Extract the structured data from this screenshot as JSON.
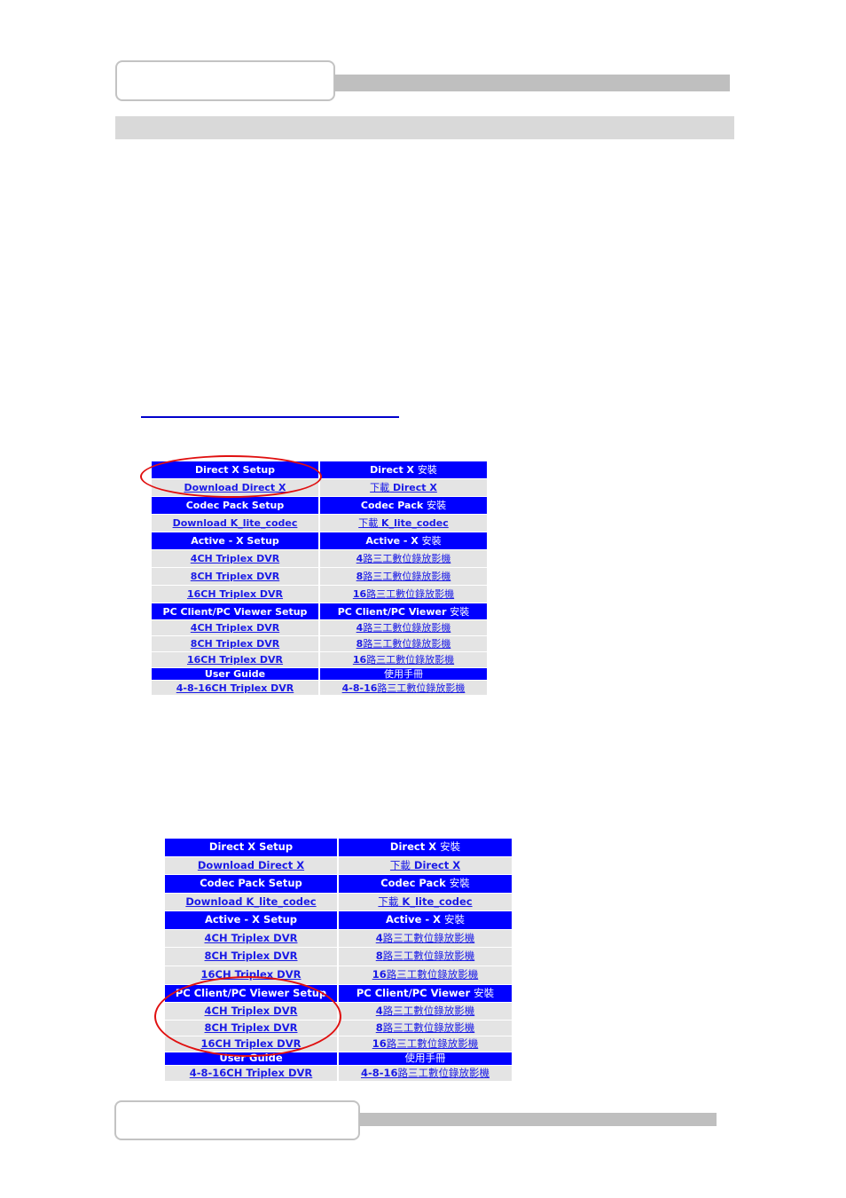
{
  "header": {
    "top_box_label": "",
    "bottom_box_label": ""
  },
  "link_rule": "",
  "colors": {
    "header_cell": "#0000ff",
    "link_cell": "#e4e4e4",
    "link_text": "#1a1ae6",
    "highlight_ellipse": "#e01010",
    "gray_bar": "#bfbfbf",
    "gray_band": "#d9d9d9"
  },
  "tables": [
    {
      "highlight": "Direct X Setup / Download Direct X",
      "rows": [
        {
          "type": "head",
          "en": "Direct X Setup",
          "zh_prefix": "Direct X ",
          "zh": "安裝",
          "zh_suffix": ""
        },
        {
          "type": "link",
          "en": "Download Direct X",
          "zh_prefix": "",
          "zh": "下載",
          "zh_suffix": " Direct X"
        },
        {
          "type": "head",
          "en": "Codec Pack Setup",
          "zh_prefix": "Codec Pack ",
          "zh": "安裝",
          "zh_suffix": ""
        },
        {
          "type": "link",
          "en": "Download K_lite_codec",
          "zh_prefix": "",
          "zh": "下載",
          "zh_suffix": " K_lite_codec"
        },
        {
          "type": "head",
          "en": "Active - X Setup",
          "zh_prefix": "Active - X ",
          "zh": "安裝",
          "zh_suffix": ""
        },
        {
          "type": "link",
          "en": "4CH Triplex DVR",
          "zh_prefix": "4",
          "zh": "路三工數位錄放影機",
          "zh_suffix": ""
        },
        {
          "type": "link",
          "en": "8CH Triplex DVR",
          "zh_prefix": "8",
          "zh": "路三工數位錄放影機",
          "zh_suffix": ""
        },
        {
          "type": "link",
          "en": "16CH Triplex DVR",
          "zh_prefix": "16",
          "zh": "路三工數位錄放影機",
          "zh_suffix": ""
        },
        {
          "type": "head",
          "en": "PC Client/PC Viewer Setup",
          "zh_prefix": "PC Client/PC Viewer ",
          "zh": "安裝",
          "zh_suffix": ""
        },
        {
          "type": "link",
          "en": "4CH Triplex DVR",
          "zh_prefix": "4",
          "zh": "路三工數位錄放影機",
          "zh_suffix": ""
        },
        {
          "type": "link",
          "en": "8CH Triplex DVR",
          "zh_prefix": "8",
          "zh": "路三工數位錄放影機",
          "zh_suffix": ""
        },
        {
          "type": "link",
          "en": "16CH Triplex DVR",
          "zh_prefix": "16",
          "zh": "路三工數位錄放影機",
          "zh_suffix": ""
        },
        {
          "type": "head",
          "en": "User Guide",
          "zh_prefix": "",
          "zh": "使用手冊",
          "zh_suffix": ""
        },
        {
          "type": "link",
          "en": "4-8-16CH Triplex DVR",
          "zh_prefix": "4-8-16",
          "zh": "路三工數位錄放影機",
          "zh_suffix": ""
        }
      ]
    },
    {
      "highlight": "PC Client/PC Viewer Setup / 4CH, 8CH, 16CH Triplex DVR",
      "rows": [
        {
          "type": "head",
          "en": "Direct X Setup",
          "zh_prefix": "Direct X ",
          "zh": "安裝",
          "zh_suffix": ""
        },
        {
          "type": "link",
          "en": "Download Direct X",
          "zh_prefix": "",
          "zh": "下載",
          "zh_suffix": " Direct X"
        },
        {
          "type": "head",
          "en": "Codec Pack Setup",
          "zh_prefix": "Codec Pack ",
          "zh": "安裝",
          "zh_suffix": ""
        },
        {
          "type": "link",
          "en": "Download K_lite_codec",
          "zh_prefix": "",
          "zh": "下載",
          "zh_suffix": " K_lite_codec"
        },
        {
          "type": "head",
          "en": "Active - X Setup",
          "zh_prefix": "Active - X ",
          "zh": "安裝",
          "zh_suffix": ""
        },
        {
          "type": "link",
          "en": "4CH Triplex DVR",
          "zh_prefix": "4",
          "zh": "路三工數位錄放影機",
          "zh_suffix": ""
        },
        {
          "type": "link",
          "en": "8CH Triplex DVR",
          "zh_prefix": "8",
          "zh": "路三工數位錄放影機",
          "zh_suffix": ""
        },
        {
          "type": "link",
          "en": "16CH Triplex DVR",
          "zh_prefix": "16",
          "zh": "路三工數位錄放影機",
          "zh_suffix": ""
        },
        {
          "type": "head",
          "en": "PC Client/PC Viewer Setup",
          "zh_prefix": "PC Client/PC Viewer ",
          "zh": "安裝",
          "zh_suffix": ""
        },
        {
          "type": "link",
          "en": "4CH Triplex DVR",
          "zh_prefix": "4",
          "zh": "路三工數位錄放影機",
          "zh_suffix": ""
        },
        {
          "type": "link",
          "en": "8CH Triplex DVR",
          "zh_prefix": "8",
          "zh": "路三工數位錄放影機",
          "zh_suffix": ""
        },
        {
          "type": "link",
          "en": "16CH Triplex DVR",
          "zh_prefix": "16",
          "zh": "路三工數位錄放影機",
          "zh_suffix": ""
        },
        {
          "type": "head",
          "en": "User Guide",
          "zh_prefix": "",
          "zh": "使用手冊",
          "zh_suffix": ""
        },
        {
          "type": "link",
          "en": "4-8-16CH Triplex DVR",
          "zh_prefix": "4-8-16",
          "zh": "路三工數位錄放影機",
          "zh_suffix": ""
        }
      ]
    }
  ]
}
